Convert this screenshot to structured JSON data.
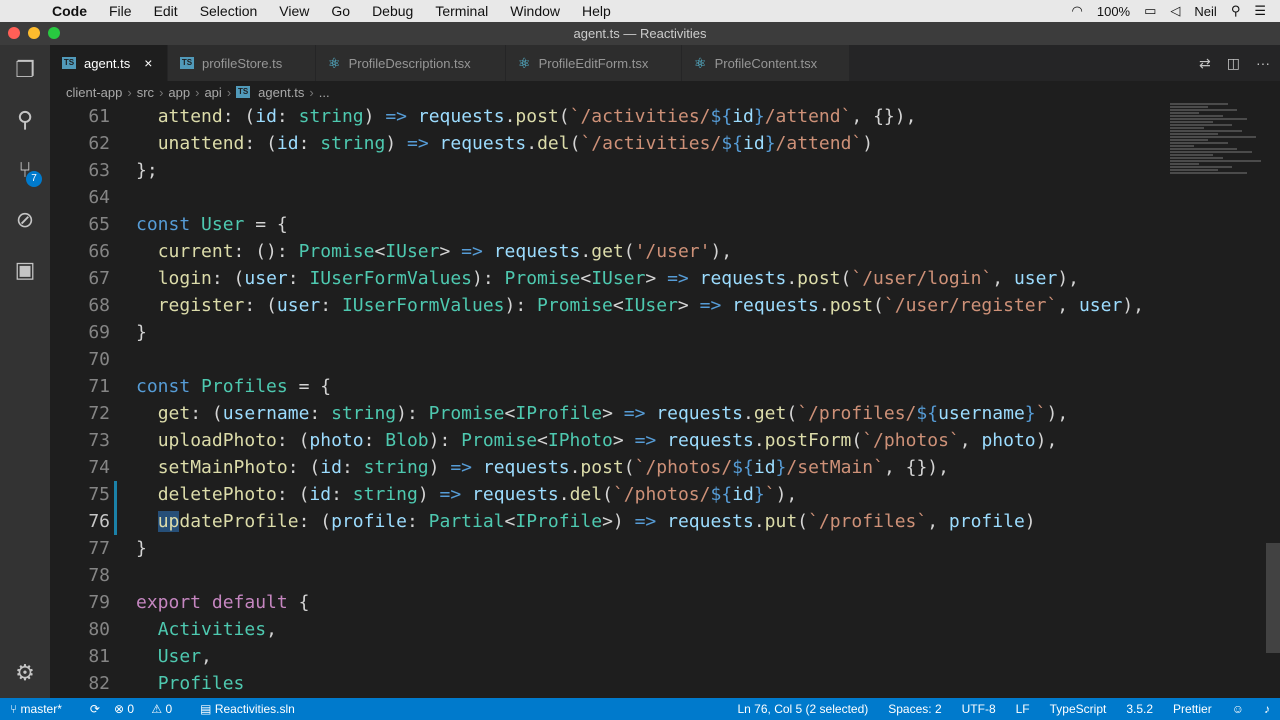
{
  "menubar": {
    "app_name": "Code",
    "items": [
      "File",
      "Edit",
      "Selection",
      "View",
      "Go",
      "Debug",
      "Terminal",
      "Window",
      "Help"
    ],
    "battery": "100%",
    "user": "Neil"
  },
  "window": {
    "title": "agent.ts — Reactivities"
  },
  "tabs": [
    {
      "label": "agent.ts",
      "icon": "typescript-file-icon",
      "active": true
    },
    {
      "label": "profileStore.ts",
      "icon": "typescript-file-icon"
    },
    {
      "label": "ProfileDescription.tsx",
      "icon": "react-file-icon"
    },
    {
      "label": "ProfileEditForm.tsx",
      "icon": "react-file-icon"
    },
    {
      "label": "ProfileContent.tsx",
      "icon": "react-file-icon"
    }
  ],
  "breadcrumbs": [
    "client-app",
    "src",
    "app",
    "api",
    "agent.ts",
    "..."
  ],
  "activitybar": {
    "scm_badge": "7"
  },
  "editor": {
    "lines": [
      {
        "n": "61"
      },
      {
        "n": "62"
      },
      {
        "n": "63"
      },
      {
        "n": "64"
      },
      {
        "n": "65"
      },
      {
        "n": "66"
      },
      {
        "n": "67"
      },
      {
        "n": "68"
      },
      {
        "n": "69"
      },
      {
        "n": "70"
      },
      {
        "n": "71"
      },
      {
        "n": "72"
      },
      {
        "n": "73"
      },
      {
        "n": "74"
      },
      {
        "n": "75"
      },
      {
        "n": "76"
      },
      {
        "n": "77"
      },
      {
        "n": "78"
      },
      {
        "n": "79"
      },
      {
        "n": "80"
      },
      {
        "n": "81"
      },
      {
        "n": "82"
      }
    ]
  },
  "statusbar": {
    "branch": "master*",
    "errors": "0",
    "warnings": "0",
    "solution": "Reactivities.sln",
    "position": "Ln 76, Col 5 (2 selected)",
    "spaces": "Spaces: 2",
    "encoding": "UTF-8",
    "eol": "LF",
    "language": "TypeScript",
    "ts_version": "3.5.2",
    "formatter": "Prettier"
  },
  "colors": {
    "statusbar": "#007acc",
    "editor_bg": "#1e1e1e",
    "keyword": "#569cd6",
    "type": "#4ec9b0",
    "string": "#ce9178"
  }
}
